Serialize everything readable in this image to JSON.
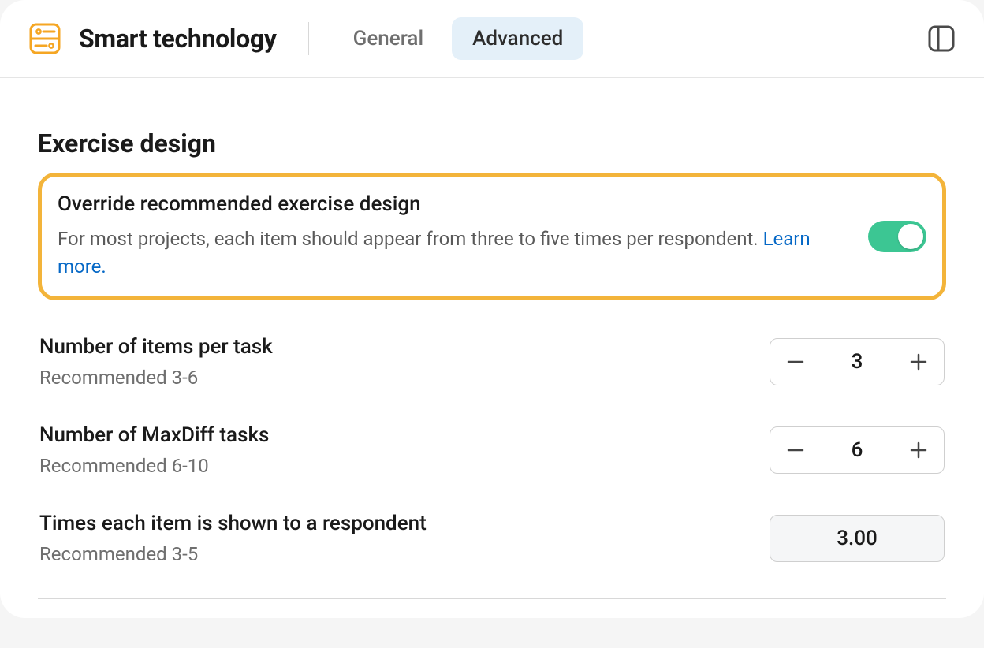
{
  "header": {
    "title": "Smart technology",
    "tabs": {
      "general": "General",
      "advanced": "Advanced"
    }
  },
  "section": {
    "title": "Exercise design"
  },
  "override": {
    "title": "Override recommended exercise design",
    "description": "For most projects, each item should appear from three to five times per respondent. ",
    "learn_more": "Learn more.",
    "toggle_on": true
  },
  "items_per_task": {
    "title": "Number of items per task",
    "sub": "Recommended 3-6",
    "value": "3"
  },
  "maxdiff_tasks": {
    "title": "Number of MaxDiff tasks",
    "sub": "Recommended 6-10",
    "value": "6"
  },
  "times_shown": {
    "title": "Times each item is shown to a respondent",
    "sub": "Recommended 3-5",
    "value": "3.00"
  }
}
